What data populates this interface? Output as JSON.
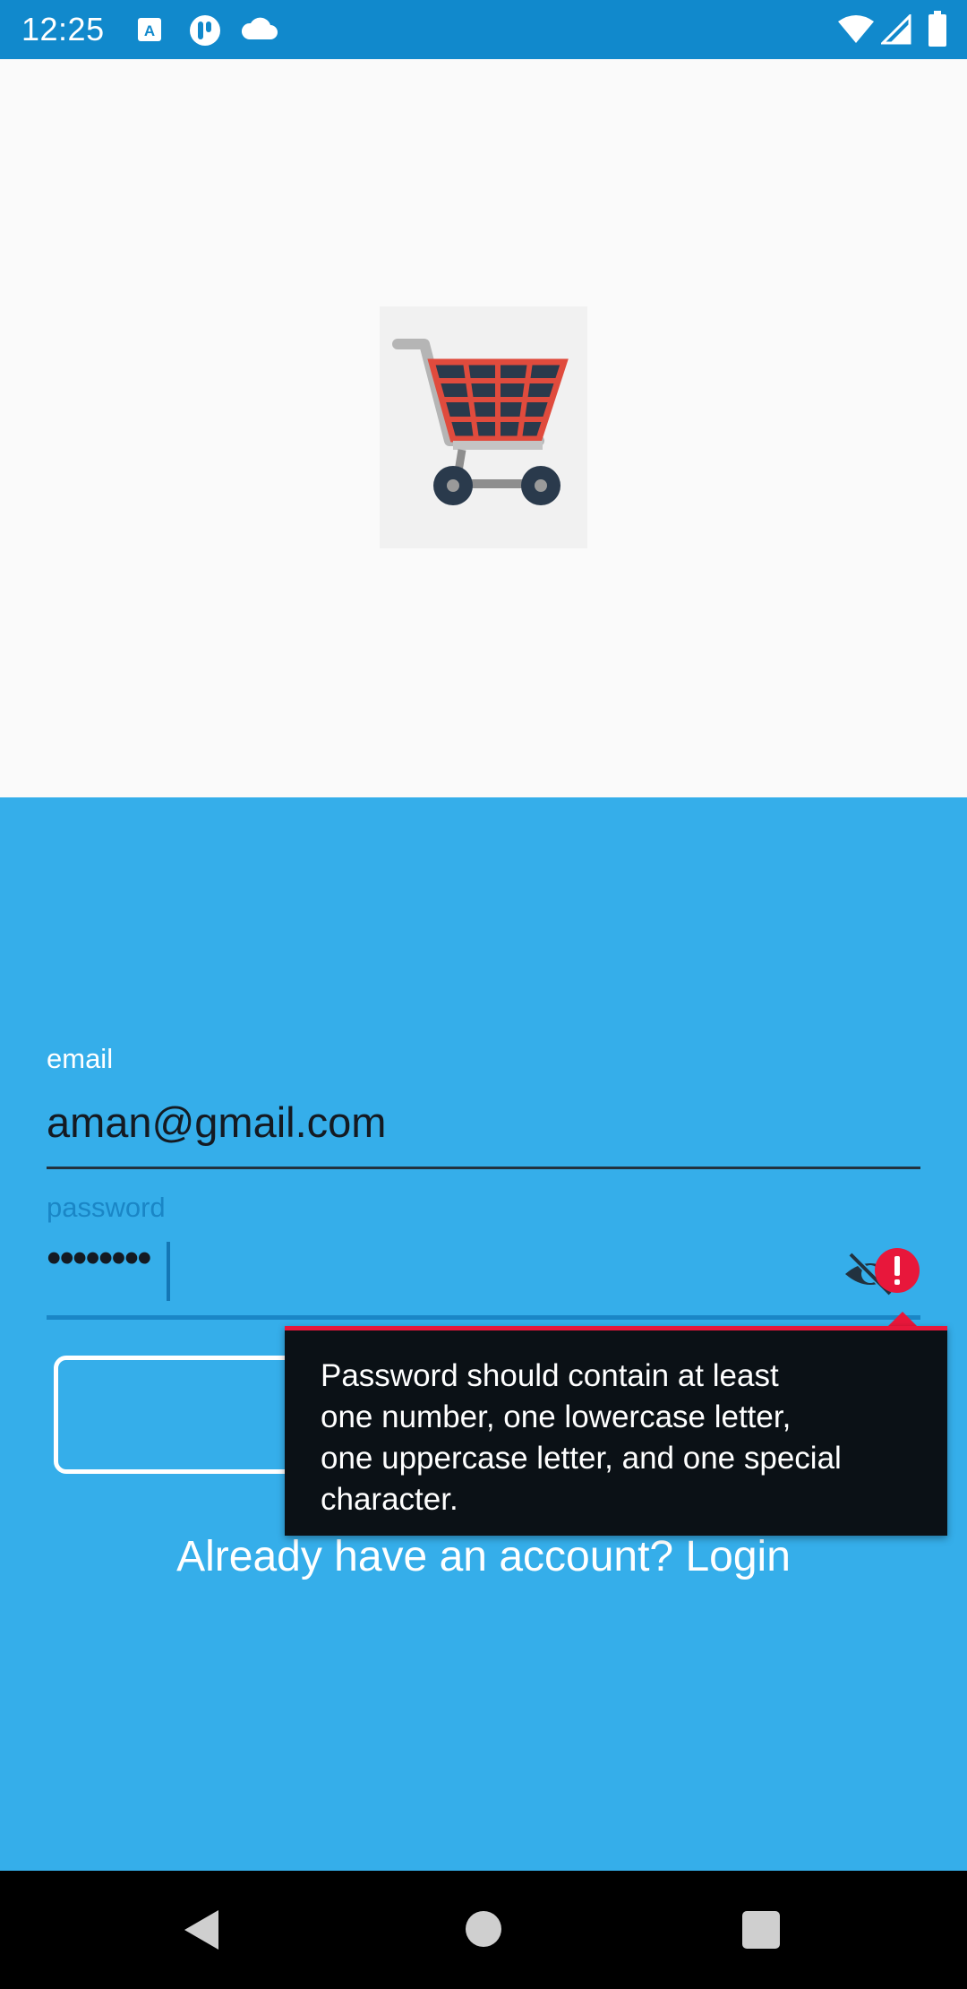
{
  "status_bar": {
    "time": "12:25",
    "left_icons": [
      "a-icon",
      "pocket-icon",
      "cloud-icon"
    ],
    "right_icons": [
      "wifi-icon",
      "signal-icon",
      "battery-icon"
    ]
  },
  "logo": {
    "icon": "shopping-cart-icon"
  },
  "form": {
    "email_label": "email",
    "email_value": "aman@gmail.com",
    "password_label": "password",
    "password_value": "••••••••",
    "signup_button_label": "",
    "login_link": "Already have an account? Login"
  },
  "error_tooltip": {
    "line1": "Password should contain at least",
    "line2": "one number, one lowercase letter,",
    "line3": "one uppercase letter, and one special",
    "line4": "character."
  },
  "colors": {
    "status_bar": "#1189cc",
    "form_background": "#35aeea",
    "error": "#e8173b",
    "tooltip_background": "#0b1116"
  }
}
